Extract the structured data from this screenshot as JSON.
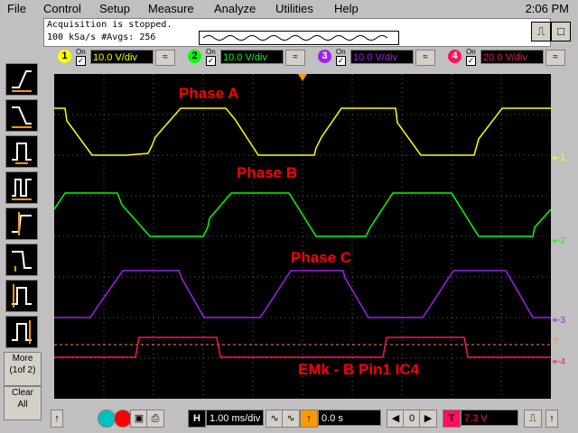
{
  "menu": {
    "items": [
      "File",
      "Control",
      "Setup",
      "Measure",
      "Analyze",
      "Utilities",
      "Help"
    ],
    "clock": "2:06 PM"
  },
  "status": {
    "line1": "Acquisition is stopped.",
    "line2": "100 kSa/s    #Avgs: 256"
  },
  "channels": [
    {
      "num": "1",
      "on_label": "On",
      "scale": "10.0 V/div",
      "color": "#ffff00"
    },
    {
      "num": "2",
      "on_label": "On",
      "scale": "10.0 V/div",
      "color": "#00ff00"
    },
    {
      "num": "3",
      "on_label": "On",
      "scale": "10.0 V/div",
      "color": "#a020f0"
    },
    {
      "num": "4",
      "on_label": "On",
      "scale": "20.0 V/div",
      "color": "#ff1060"
    }
  ],
  "left_panel": {
    "more_label": "More",
    "page_label": "(1of 2)",
    "clear_label": "Clear",
    "all_label": "All"
  },
  "trace_labels": {
    "phase_a": "Phase A",
    "phase_b": "Phase B",
    "phase_c": "Phase C",
    "emk": "EMk - B Pin1 IC4"
  },
  "bottom": {
    "h_label": "H",
    "timebase": "1.00 ms/div",
    "t_label": "T",
    "delay": "0.0 s",
    "trig_level": "7.3 V",
    "trigger_marker": "T"
  },
  "colors": {
    "accent_background": "#c0c0c0",
    "scope_background": "#000000"
  }
}
